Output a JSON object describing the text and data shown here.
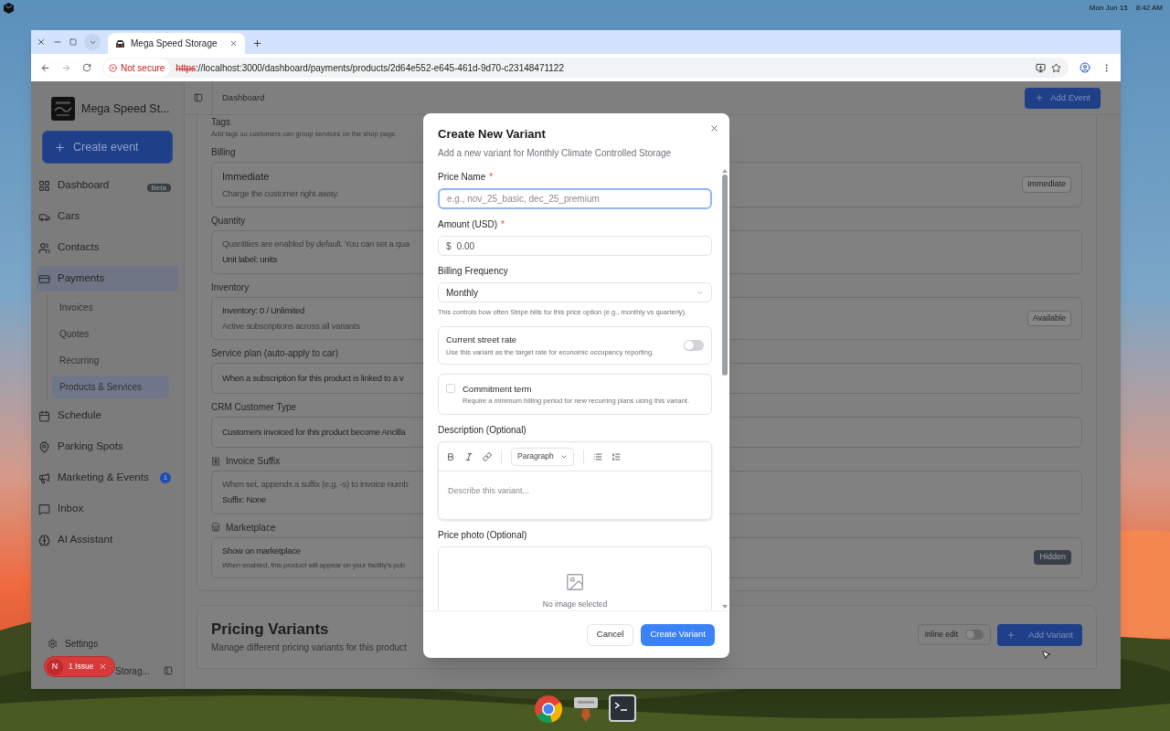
{
  "desktop": {
    "date": "Mon Jun 15",
    "time": "8:42 AM"
  },
  "browser": {
    "tab_title": "Mega Speed Storage",
    "security": "Not secure",
    "url_scheme": "https",
    "url_rest": "://localhost:3000/dashboard/payments/products/2d64e552-e645-461d-9d70-c23148471122"
  },
  "sidebar": {
    "brand": "Mega Speed St...",
    "create_button": "Create event",
    "items": [
      {
        "label": "Dashboard",
        "selected": false,
        "badge": {
          "text": "Beta",
          "kind": "tag"
        }
      },
      {
        "label": "Cars",
        "selected": false
      },
      {
        "label": "Contacts",
        "selected": false
      },
      {
        "label": "Payments",
        "selected": true,
        "expanded": true,
        "children": [
          {
            "label": "Invoices",
            "selected": false
          },
          {
            "label": "Quotes",
            "selected": false
          },
          {
            "label": "Recurring",
            "selected": false
          },
          {
            "label": "Products & Services",
            "selected": true
          }
        ]
      },
      {
        "label": "Schedule",
        "selected": false
      },
      {
        "label": "Parking Spots",
        "selected": false
      },
      {
        "label": "Marketing & Events",
        "selected": false,
        "badge": {
          "text": "1",
          "kind": "count"
        }
      },
      {
        "label": "Inbox",
        "selected": false
      },
      {
        "label": "AI Assistant",
        "selected": false
      }
    ],
    "settings": "Settings",
    "footer": "Storag..."
  },
  "issue_badge": {
    "letter": "N",
    "label": "1 Issue"
  },
  "header": {
    "breadcrumb": "Dashboard",
    "add_button": "Add Event"
  },
  "sections": [
    {
      "heading": "Tags",
      "kind": "hint",
      "hint": "Add tags so customers can group services on the shop page."
    },
    {
      "heading": "Billing",
      "kind": "card",
      "lines": [
        {
          "text": "Immediate",
          "kind": "title"
        },
        {
          "text": "Charge the customer right away.",
          "kind": "muted"
        }
      ],
      "badge": {
        "text": "Immediate",
        "kind": "outline"
      }
    },
    {
      "heading": "Quantity",
      "kind": "card",
      "lines": [
        {
          "text": "Quantities are enabled by default. You can set a qua",
          "kind": "muted"
        },
        {
          "text": "Unit label: units",
          "kind": "body"
        }
      ]
    },
    {
      "heading": "Inventory",
      "kind": "card",
      "lines": [
        {
          "text": "Inventory: 0 / Unlimited",
          "kind": "body"
        },
        {
          "text": "Active subscriptions across all variants",
          "kind": "muted"
        }
      ],
      "badge": {
        "text": "Available",
        "kind": "outline"
      }
    },
    {
      "heading": "Service plan (auto-apply to car)",
      "kind": "card",
      "lines": [
        {
          "text": "When a subscription for this product is linked to a v",
          "kind": "body"
        }
      ]
    },
    {
      "heading": "CRM Customer Type",
      "kind": "card",
      "lines": [
        {
          "text": "Customers invoiced for this product become Ancilla",
          "kind": "body"
        }
      ]
    },
    {
      "heading": "Invoice Suffix",
      "kind": "card",
      "lines": [
        {
          "text": "When set, appends a suffix (e.g. -s) to invoice numb",
          "kind": "muted"
        },
        {
          "text": "Suffix: None",
          "kind": "body"
        }
      ]
    },
    {
      "heading": "Marketplace",
      "kind": "card",
      "lines": [
        {
          "text": "Show on marketplace",
          "kind": "body"
        },
        {
          "text": "When enabled, this product will appear on your facility's pub",
          "kind": "small"
        }
      ],
      "badge": {
        "text": "Hidden",
        "kind": "solid"
      }
    }
  ],
  "pricing": {
    "title": "Pricing Variants",
    "subtitle": "Manage different pricing variants for this product",
    "inline_edit": {
      "label": "Inline edit",
      "on": false
    },
    "add_button": "Add Variant"
  },
  "modal": {
    "title": "Create New Variant",
    "required_mark": "*",
    "subtitle": "Add a new variant for Monthly Climate Controlled Storage",
    "price_name": {
      "label": "Price Name",
      "required": true,
      "placeholder": "e.g., nov_25_basic, dec_25_premium",
      "focused": true
    },
    "amount": {
      "label": "Amount (USD)",
      "required": true,
      "prefix": "$",
      "placeholder": "0.00"
    },
    "billing_frequency": {
      "label": "Billing Frequency",
      "value": "Monthly",
      "help": "This controls how often Stripe bills for this price option (e.g., monthly vs quarterly)."
    },
    "street_rate": {
      "title": "Current street rate",
      "description": "Use this variant as the target rate for economic occupancy reporting.",
      "on": false
    },
    "commitment": {
      "title": "Commitment term",
      "description": "Require a minimum billing period for new recurring plans using this variant.",
      "checked": false
    },
    "description": {
      "label": "Description (Optional)",
      "block_style": "Paragraph",
      "placeholder": "Describe this variant..."
    },
    "photo": {
      "label": "Price photo (Optional)",
      "empty_text": "No image selected"
    },
    "buttons": {
      "cancel": "Cancel",
      "submit": "Create Variant"
    }
  }
}
